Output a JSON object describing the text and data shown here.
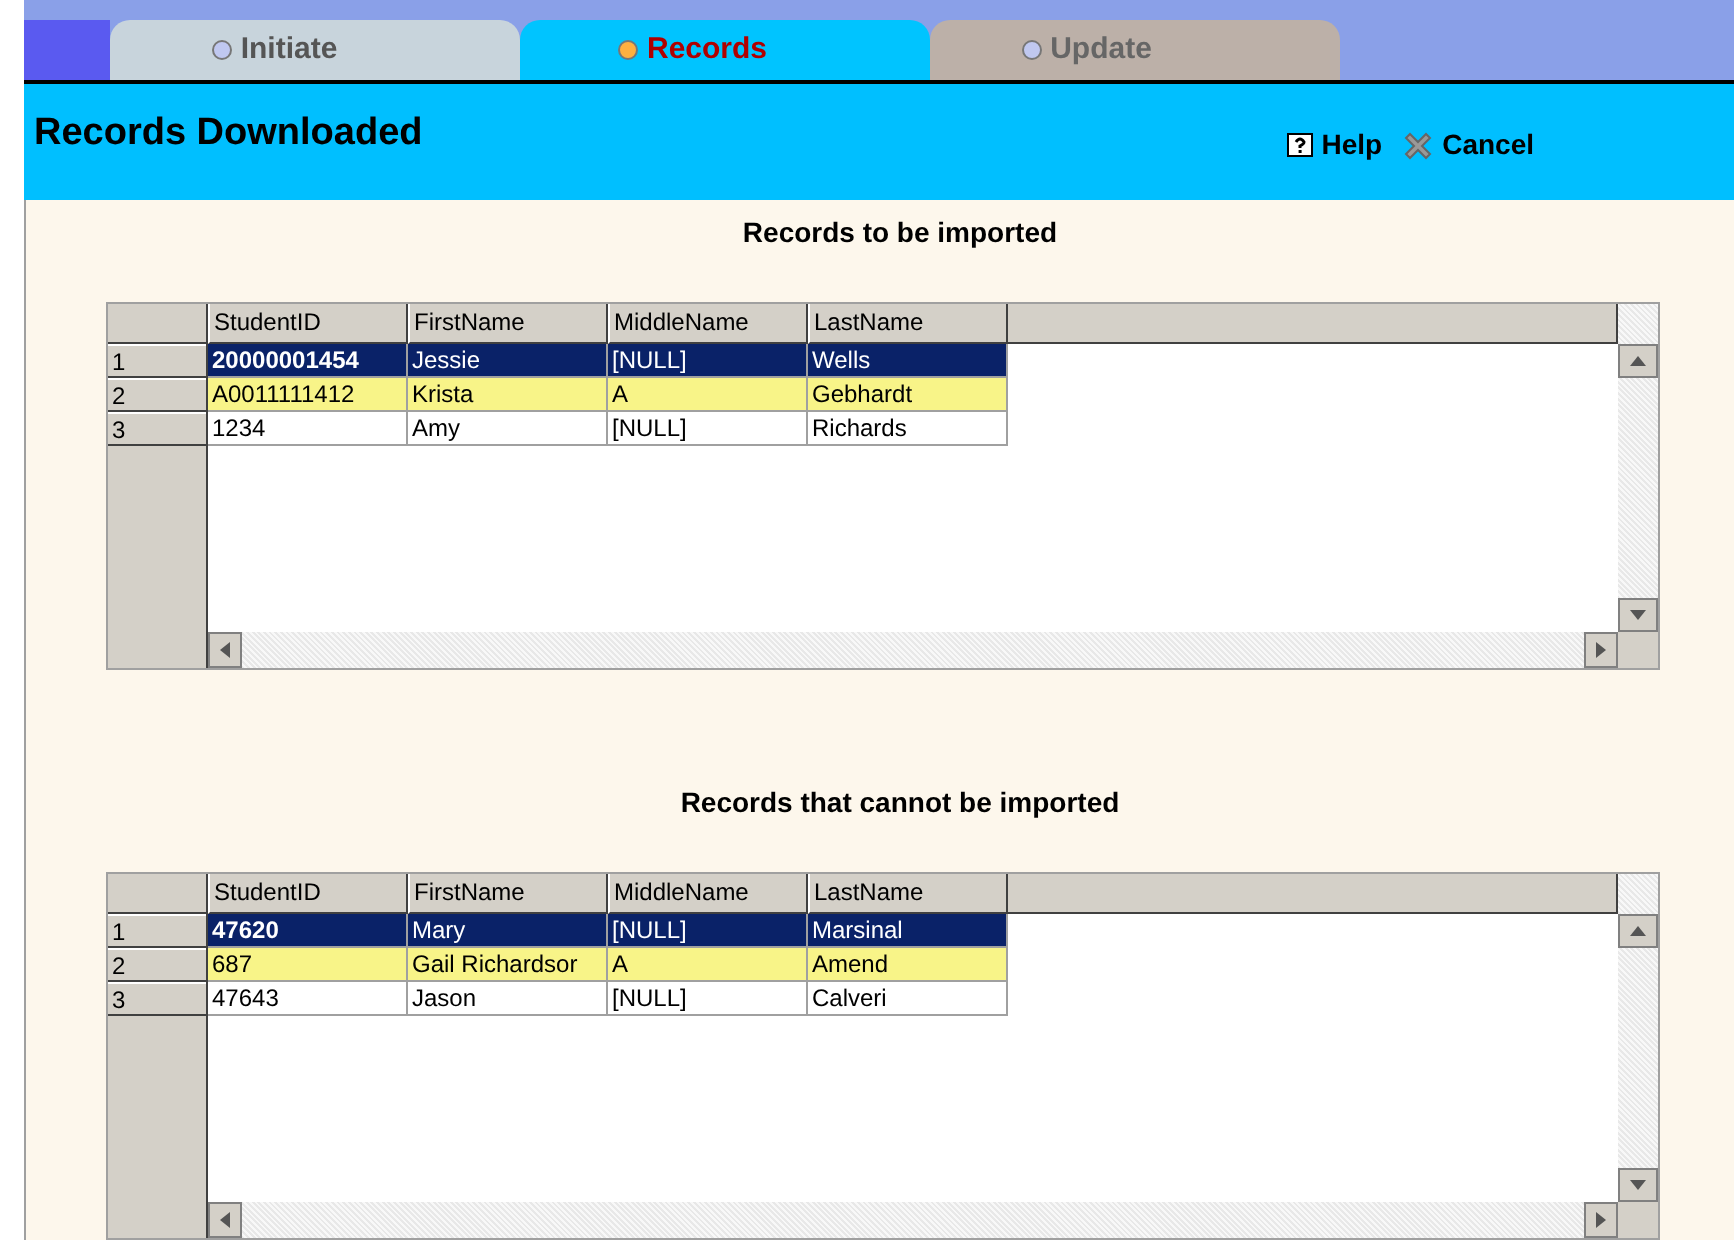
{
  "tabs": [
    {
      "label": "Initiate",
      "selected": false
    },
    {
      "label": "Records",
      "selected": true
    },
    {
      "label": "Update",
      "selected": false
    }
  ],
  "header": {
    "title": "Records Downloaded",
    "actions": [
      {
        "kind": "help",
        "label": "Help"
      },
      {
        "kind": "cancel",
        "label": "Cancel"
      }
    ]
  },
  "grids": [
    {
      "title": "Records to be imported",
      "columns": [
        "StudentID",
        "FirstName",
        "MiddleName",
        "LastName"
      ],
      "rows": [
        {
          "number": "1",
          "cells": [
            "20000001454",
            "Jessie",
            "[NULL]",
            "Wells"
          ],
          "selected": true,
          "highlighted": false
        },
        {
          "number": "2",
          "cells": [
            "A0011111412",
            "Krista",
            "A",
            "Gebhardt"
          ],
          "selected": false,
          "highlighted": true
        },
        {
          "number": "3",
          "cells": [
            "1234",
            "Amy",
            "[NULL]",
            "Richards"
          ],
          "selected": false,
          "highlighted": false
        }
      ]
    },
    {
      "title": "Records that cannot be imported",
      "columns": [
        "StudentID",
        "FirstName",
        "MiddleName",
        "LastName"
      ],
      "rows": [
        {
          "number": "1",
          "cells": [
            "47620",
            "Mary",
            "[NULL]",
            "Marsinal"
          ],
          "selected": true,
          "highlighted": false
        },
        {
          "number": "2",
          "cells": [
            "687",
            "Gail Richardsor",
            "A",
            "Amend"
          ],
          "selected": false,
          "highlighted": true
        },
        {
          "number": "3",
          "cells": [
            "47643",
            "Jason",
            "[NULL]",
            "Calveri"
          ],
          "selected": false,
          "highlighted": false
        }
      ]
    }
  ]
}
